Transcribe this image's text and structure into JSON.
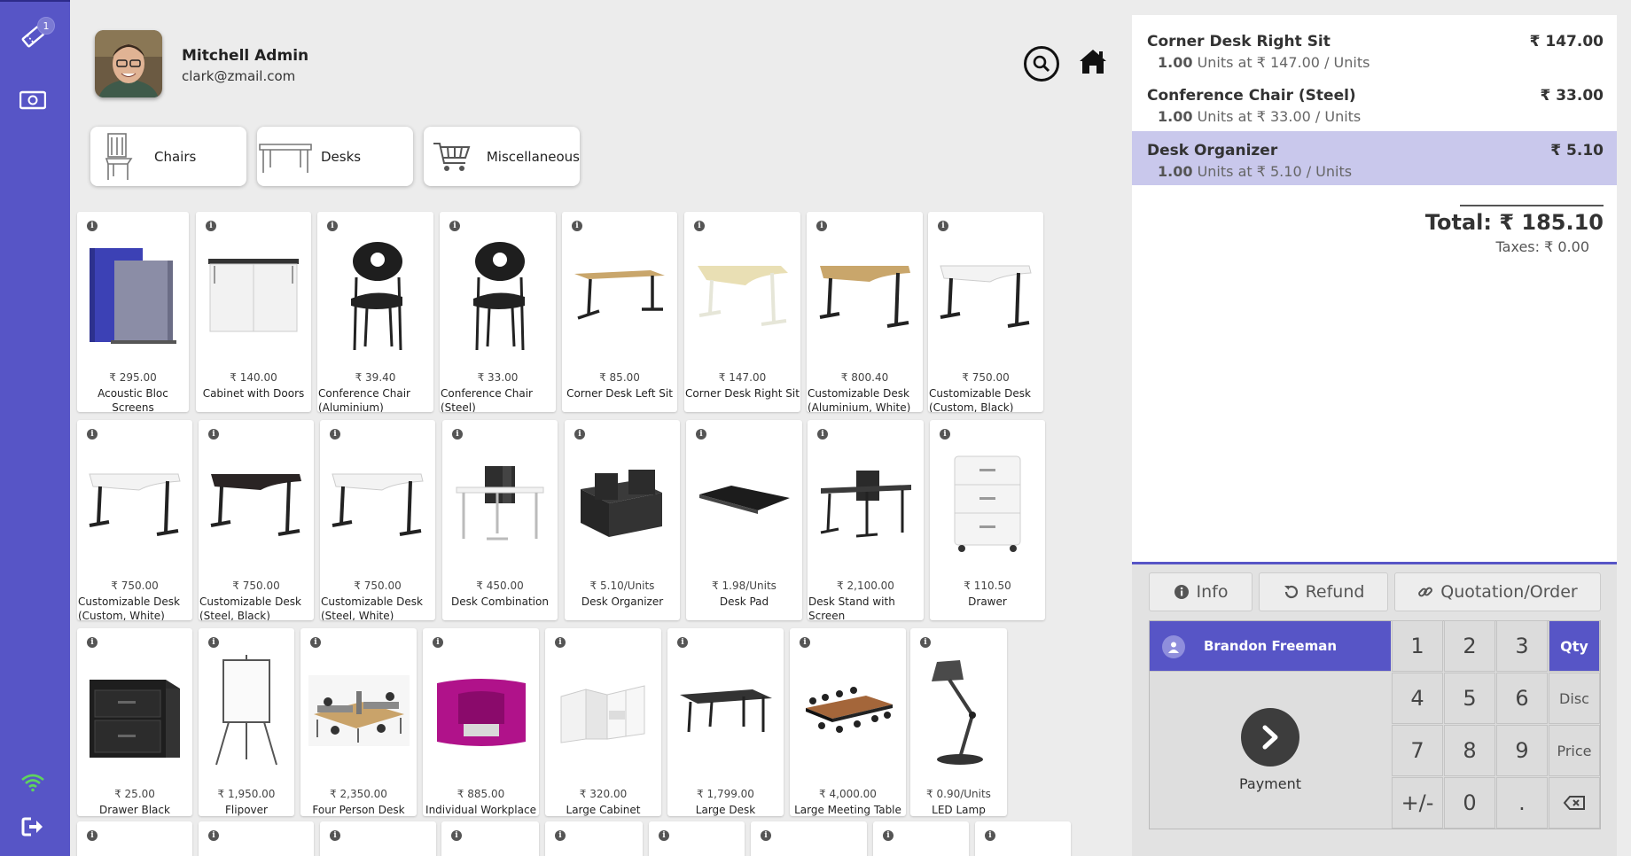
{
  "sidebar": {
    "badge_count": "1",
    "icons": [
      "ticket-icon",
      "cash-icon",
      "wifi-icon",
      "logout-icon"
    ]
  },
  "header": {
    "user_name": "Mitchell Admin",
    "user_email": "clark@zmail.com"
  },
  "categories": [
    {
      "label": "Chairs"
    },
    {
      "label": "Desks"
    },
    {
      "label": "Miscellaneous"
    }
  ],
  "products": [
    {
      "price": "₹ 295.00",
      "name": "Acoustic Bloc Screens"
    },
    {
      "price": "₹ 140.00",
      "name": "Cabinet with Doors"
    },
    {
      "price": "₹ 39.40",
      "name": "Conference Chair (Aluminium)"
    },
    {
      "price": "₹ 33.00",
      "name": "Conference Chair (Steel)"
    },
    {
      "price": "₹ 85.00",
      "name": "Corner Desk Left Sit"
    },
    {
      "price": "₹ 147.00",
      "name": "Corner Desk Right Sit"
    },
    {
      "price": "₹ 800.40",
      "name": "Customizable Desk (Aluminium, White)"
    },
    {
      "price": "₹ 750.00",
      "name": "Customizable Desk (Custom, Black)"
    },
    {
      "price": "₹ 750.00",
      "name": "Customizable Desk (Custom, White)"
    },
    {
      "price": "₹ 750.00",
      "name": "Customizable Desk (Steel, Black)"
    },
    {
      "price": "₹ 750.00",
      "name": "Customizable Desk (Steel, White)"
    },
    {
      "price": "₹ 450.00",
      "name": "Desk Combination"
    },
    {
      "price": "₹ 5.10/Units",
      "name": "Desk Organizer"
    },
    {
      "price": "₹ 1.98/Units",
      "name": "Desk Pad"
    },
    {
      "price": "₹ 2,100.00",
      "name": "Desk Stand with Screen"
    },
    {
      "price": "₹ 110.50",
      "name": "Drawer"
    },
    {
      "price": "₹ 25.00",
      "name": "Drawer Black"
    },
    {
      "price": "₹ 1,950.00",
      "name": "Flipover"
    },
    {
      "price": "₹ 2,350.00",
      "name": "Four Person Desk"
    },
    {
      "price": "₹ 885.00",
      "name": "Individual Workplace"
    },
    {
      "price": "₹ 320.00",
      "name": "Large Cabinet"
    },
    {
      "price": "₹ 1,799.00",
      "name": "Large Desk"
    },
    {
      "price": "₹ 4,000.00",
      "name": "Large Meeting Table"
    },
    {
      "price": "₹ 0.90/Units",
      "name": "LED Lamp"
    }
  ],
  "order": {
    "lines": [
      {
        "name": "Corner Desk Right Sit",
        "price": "₹ 147.00",
        "qty": "1.00",
        "detail": " Units at ₹ 147.00 / Units"
      },
      {
        "name": "Conference Chair (Steel)",
        "price": "₹ 33.00",
        "qty": "1.00",
        "detail": " Units at ₹ 33.00 / Units"
      },
      {
        "name": "Desk Organizer",
        "price": "₹ 5.10",
        "qty": "1.00",
        "detail": " Units at ₹ 5.10 / Units"
      }
    ],
    "total": "Total: ₹ 185.10",
    "taxes": "Taxes: ₹ 0.00"
  },
  "controls": {
    "info": "Info",
    "refund": "Refund",
    "quotation": "Quotation/Order"
  },
  "numpad": {
    "customer": "Brandon Freeman",
    "payment": "Payment",
    "keys": [
      "1",
      "2",
      "3",
      "4",
      "5",
      "6",
      "7",
      "8",
      "9",
      "+/-",
      "0",
      "."
    ],
    "modes": [
      "Qty",
      "Disc",
      "Price"
    ],
    "active_mode": "Qty"
  },
  "colors": {
    "accent": "#5755c6",
    "selected_line": "#c9c8ec",
    "background": "#ececec"
  }
}
